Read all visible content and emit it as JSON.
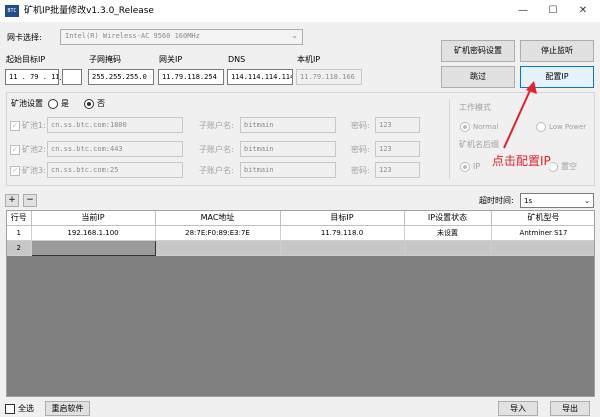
{
  "window": {
    "title": "矿机IP批量修改v1.3.0_Release",
    "icon_text": "BTC",
    "min": "—",
    "max": "☐",
    "close": "✕"
  },
  "nic": {
    "label": "网卡选择:",
    "value": "Intel(R) Wireless-AC 9560 160MHz"
  },
  "net": {
    "start_label": "起始目标IP",
    "start_ip_a": "11 . 79 . 118",
    "start_ip_b": "",
    "mask_label": "子网掩码",
    "mask": "255.255.255.0",
    "gateway_label": "网关IP",
    "gateway": "11.79.118.254",
    "dns_label": "DNS",
    "dns": "114.114.114.114",
    "local_label": "本机IP",
    "local": "11.79.118.166"
  },
  "buttons": {
    "miner_pwd": "矿机密码设置",
    "stop_listen": "停止监听",
    "skip": "跳过",
    "config_ip": "配置IP",
    "add": "+",
    "remove": "−",
    "select_all": "全选",
    "restart": "重启软件",
    "import": "导入",
    "export": "导出"
  },
  "pool": {
    "label": "矿池设置",
    "yes": "是",
    "no": "否",
    "rows": [
      {
        "label": "矿池1:",
        "url": "cn.ss.btc.com:1800",
        "user_label": "子账户名:",
        "user": "bitmain",
        "pwd_label": "密码:",
        "pwd": "123"
      },
      {
        "label": "矿池2:",
        "url": "cn.ss.btc.com:443",
        "user_label": "子账户名:",
        "user": "bitmain",
        "pwd_label": "密码:",
        "pwd": "123"
      },
      {
        "label": "矿池3:",
        "url": "cn.ss.btc.com:25",
        "user_label": "子账户名:",
        "user": "bitmain",
        "pwd_label": "密码:",
        "pwd": "123"
      }
    ],
    "mode_label": "工作模式",
    "mode_normal": "Normal",
    "mode_low": "Low Power",
    "suffix_label": "矿机名后缀",
    "suffix_ip": "IP",
    "suffix_empty": "置空"
  },
  "annotation": "点击配置IP",
  "timeout": {
    "label": "超时时间:",
    "value": "1s"
  },
  "table": {
    "headers": [
      "行号",
      "当前IP",
      "MAC地址",
      "目标IP",
      "IP设置状态",
      "矿机型号"
    ],
    "rows": [
      [
        "1",
        "192.168.1.100",
        "28:7E:F0:89:E3:7E",
        "11.79.118.0",
        "未设置",
        "Antminer S17"
      ],
      [
        "2",
        "",
        "",
        "",
        "",
        ""
      ]
    ]
  }
}
